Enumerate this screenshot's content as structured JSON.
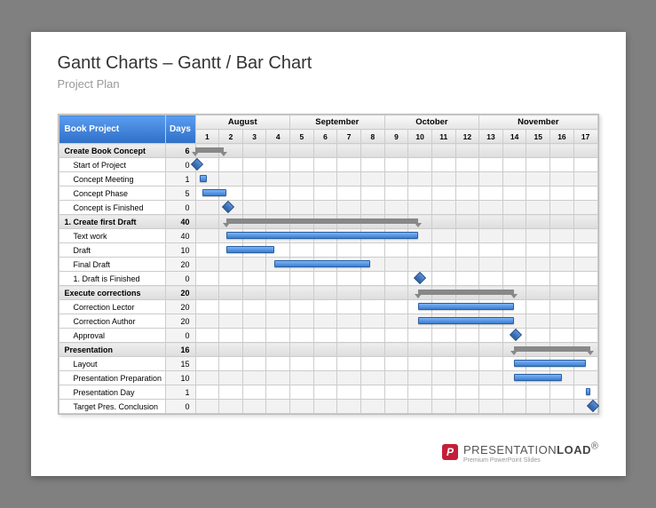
{
  "title": "Gantt Charts – Gantt / Bar Chart",
  "subtitle": "Project Plan",
  "header": {
    "project_label": "Book Project",
    "days_label": "Days"
  },
  "months": [
    {
      "name": "August",
      "span": 4
    },
    {
      "name": "September",
      "span": 4
    },
    {
      "name": "October",
      "span": 4
    },
    {
      "name": "November",
      "span": 5
    }
  ],
  "day_numbers": [
    "1",
    "2",
    "3",
    "4",
    "5",
    "6",
    "7",
    "8",
    "9",
    "10",
    "11",
    "12",
    "13",
    "14",
    "15",
    "16",
    "17"
  ],
  "rows": [
    {
      "name": "Create Book Concept",
      "days": "6",
      "group": true
    },
    {
      "name": "Start of Project",
      "days": "0",
      "sub": true
    },
    {
      "name": "Concept Meeting",
      "days": "1",
      "sub": true
    },
    {
      "name": "Concept Phase",
      "days": "5",
      "sub": true
    },
    {
      "name": "Concept is Finished",
      "days": "0",
      "sub": true
    },
    {
      "name": "1. Create first Draft",
      "days": "40",
      "group": true
    },
    {
      "name": "Text work",
      "days": "40",
      "sub": true
    },
    {
      "name": "Draft",
      "days": "10",
      "sub": true
    },
    {
      "name": "Final Draft",
      "days": "20",
      "sub": true
    },
    {
      "name": "1. Draft is Finished",
      "days": "0",
      "sub": true
    },
    {
      "name": "Execute corrections",
      "days": "20",
      "group": true
    },
    {
      "name": "Correction Lector",
      "days": "20",
      "sub": true
    },
    {
      "name": "Correction Author",
      "days": "20",
      "sub": true
    },
    {
      "name": "Approval",
      "days": "0",
      "sub": true
    },
    {
      "name": "Presentation",
      "days": "16",
      "group": true
    },
    {
      "name": "Layout",
      "days": "15",
      "sub": true
    },
    {
      "name": "Presentation Preparation",
      "days": "10",
      "sub": true
    },
    {
      "name": "Presentation Day",
      "days": "1",
      "sub": true
    },
    {
      "name": "Target Pres. Conclusion",
      "days": "0",
      "sub": true
    }
  ],
  "footer": {
    "brand_1": "PRESENTATION",
    "brand_2": "LOAD",
    "reg": "®",
    "tagline": "Premium PowerPoint Slides"
  },
  "chart_data": {
    "type": "gantt",
    "title": "Book Project – Project Plan",
    "time_axis": {
      "unit": "week",
      "columns": 17,
      "months": [
        "August",
        "September",
        "October",
        "November"
      ]
    },
    "tasks": [
      {
        "name": "Create Book Concept",
        "type": "summary",
        "start": 1,
        "end": 2.2,
        "duration_days": 6
      },
      {
        "name": "Start of Project",
        "type": "milestone",
        "at": 1,
        "duration_days": 0
      },
      {
        "name": "Concept Meeting",
        "type": "task",
        "start": 1.2,
        "end": 1.5,
        "duration_days": 1
      },
      {
        "name": "Concept Phase",
        "type": "task",
        "start": 1.3,
        "end": 2.3,
        "duration_days": 5
      },
      {
        "name": "Concept is Finished",
        "type": "milestone",
        "at": 2.3,
        "duration_days": 0
      },
      {
        "name": "1. Create first Draft",
        "type": "summary",
        "start": 2.3,
        "end": 10.3,
        "duration_days": 40
      },
      {
        "name": "Text work",
        "type": "task",
        "start": 2.3,
        "end": 10.3,
        "duration_days": 40
      },
      {
        "name": "Draft",
        "type": "task",
        "start": 2.3,
        "end": 4.3,
        "duration_days": 10
      },
      {
        "name": "Final Draft",
        "type": "task",
        "start": 4.3,
        "end": 8.3,
        "duration_days": 20
      },
      {
        "name": "1. Draft is Finished",
        "type": "milestone",
        "at": 10.3,
        "duration_days": 0
      },
      {
        "name": "Execute corrections",
        "type": "summary",
        "start": 10.3,
        "end": 14.3,
        "duration_days": 20
      },
      {
        "name": "Correction Lector",
        "type": "task",
        "start": 10.3,
        "end": 14.3,
        "duration_days": 20
      },
      {
        "name": "Correction Author",
        "type": "task",
        "start": 10.3,
        "end": 14.3,
        "duration_days": 20
      },
      {
        "name": "Approval",
        "type": "milestone",
        "at": 14.3,
        "duration_days": 0
      },
      {
        "name": "Presentation",
        "type": "summary",
        "start": 14.3,
        "end": 17.5,
        "duration_days": 16
      },
      {
        "name": "Layout",
        "type": "task",
        "start": 14.3,
        "end": 17.3,
        "duration_days": 15
      },
      {
        "name": "Presentation Preparation",
        "type": "task",
        "start": 14.3,
        "end": 16.3,
        "duration_days": 10
      },
      {
        "name": "Presentation Day",
        "type": "task",
        "start": 17.3,
        "end": 17.5,
        "duration_days": 1
      },
      {
        "name": "Target Pres. Conclusion",
        "type": "milestone",
        "at": 17.5,
        "duration_days": 0
      }
    ]
  }
}
